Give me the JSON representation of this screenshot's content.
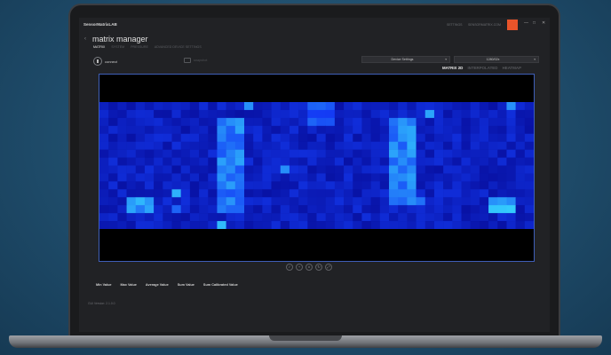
{
  "app": {
    "name": "SensorMatrixLAB",
    "title": "matrix manager",
    "links": [
      "SETTINGS",
      "SENSORMATRIX.COM"
    ],
    "window_controls": [
      "—",
      "□",
      "✕"
    ]
  },
  "subtabs": [
    {
      "label": "MATRIX",
      "active": true
    },
    {
      "label": "SYSTEM",
      "active": false
    },
    {
      "label": "PRESSURE",
      "active": false
    },
    {
      "label": "ADVANCED DEVICE SETTINGS",
      "active": false
    }
  ],
  "toolbar": {
    "connect_label": "connect",
    "snapshot_label": "snapshot"
  },
  "selects": {
    "device_settings": "Device Settings",
    "baud_rate": "1280/02x"
  },
  "view_tabs": [
    {
      "label": "MATRIX 2D",
      "active": true
    },
    {
      "label": "INTERPOLATED",
      "active": false
    },
    {
      "label": "HEATMAP",
      "active": false
    }
  ],
  "stats": [
    "Min Value",
    "Max Value",
    "Average Value",
    "Sum Value",
    "Sum Calibrated Value"
  ],
  "version": "GUI Version: 2.1.0.0",
  "colors": {
    "accent_orange": "#e8542a",
    "frame_border": "#3f5fb8",
    "heat_low": "#0a14a8",
    "heat_high": "#36f0ff"
  },
  "icons": {
    "connect": "plug-icon",
    "snapshot": "camera-icon",
    "tools": [
      "check-icon",
      "crosshair-icon",
      "grid-icon",
      "rotate-icon",
      "expand-icon"
    ]
  },
  "chart_data": {
    "type": "heatmap",
    "rows": 16,
    "cols": 48,
    "hotspots": [
      {
        "row_start": 2,
        "row_end": 13,
        "col_start": 13,
        "col_end": 15,
        "intensity": 0.75
      },
      {
        "row_start": 2,
        "row_end": 12,
        "col_start": 32,
        "col_end": 34,
        "intensity": 0.78
      },
      {
        "row_start": 0,
        "row_end": 2,
        "col_start": 23,
        "col_end": 25,
        "intensity": 0.65
      },
      {
        "row_start": 12,
        "row_end": 13,
        "col_start": 3,
        "col_end": 5,
        "intensity": 0.85
      },
      {
        "row_start": 12,
        "row_end": 13,
        "col_start": 43,
        "col_end": 45,
        "intensity": 0.9
      }
    ]
  }
}
